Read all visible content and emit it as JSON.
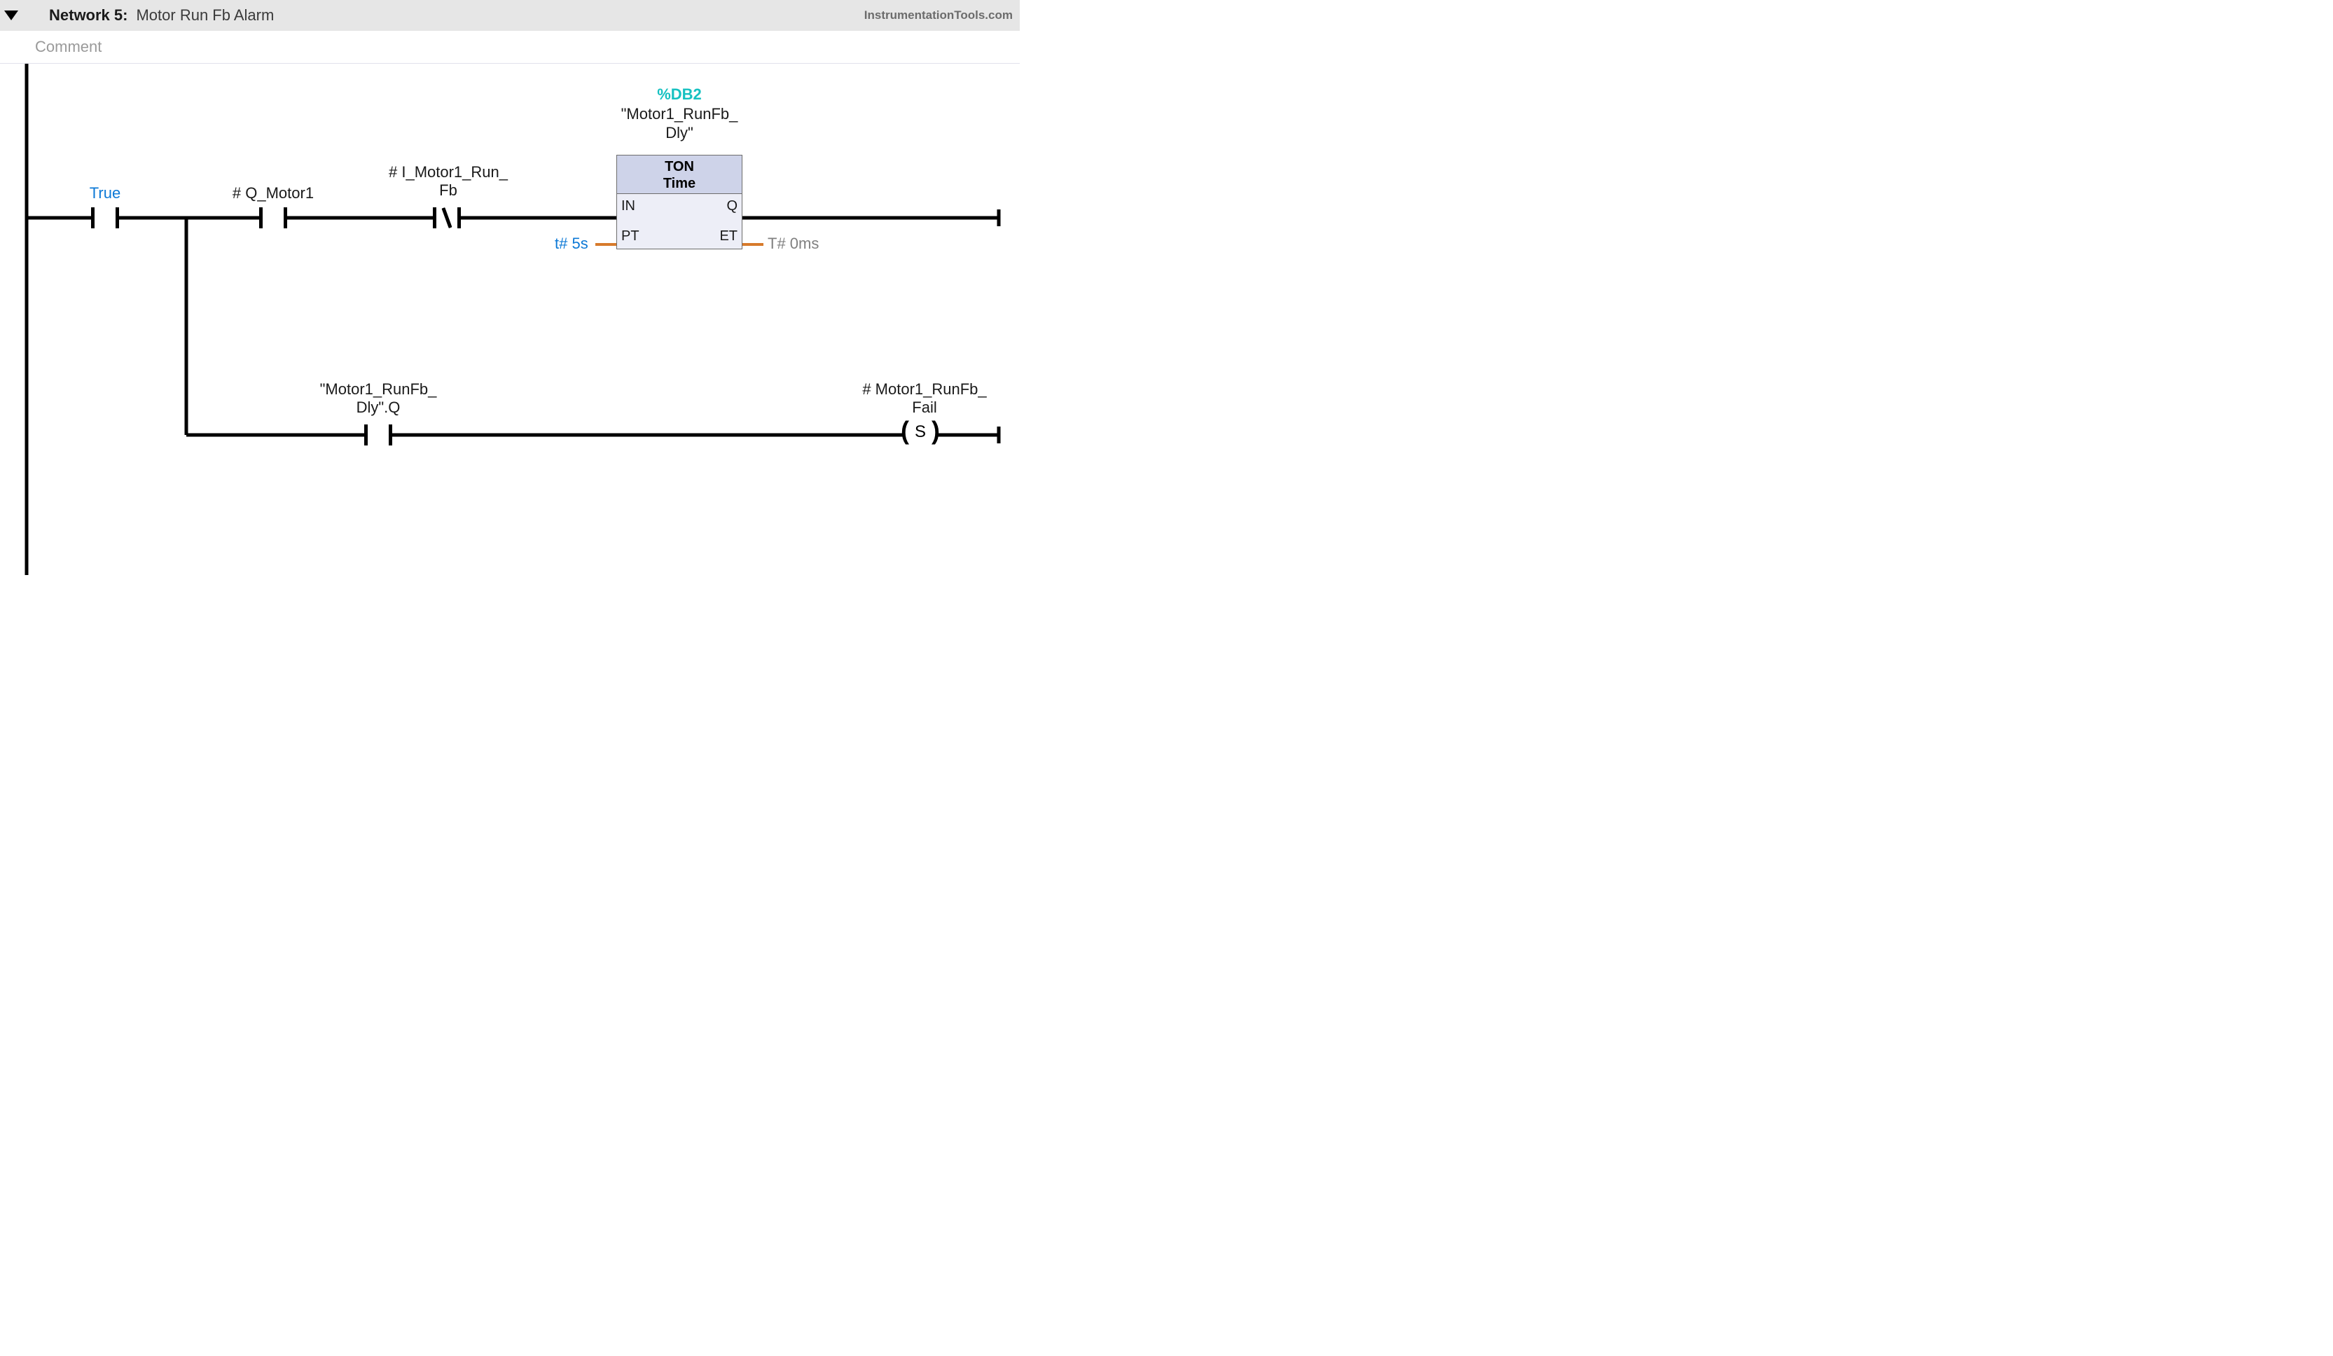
{
  "header": {
    "network_label": "Network 5:",
    "network_title": "Motor Run Fb Alarm",
    "brand": "InstrumentationTools.com"
  },
  "comment_placeholder": "Comment",
  "rung1": {
    "true_label": "True",
    "q_motor1_label": "# Q_Motor1",
    "i_motor1_runfb_line1": "# I_Motor1_Run_",
    "i_motor1_runfb_line2": "Fb"
  },
  "timer": {
    "db_label": "%DB2",
    "instance_line1": "\"Motor1_RunFb_",
    "instance_line2": "Dly\"",
    "type": "TON",
    "subtype": "Time",
    "pin_in": "IN",
    "pin_pt": "PT",
    "pin_q": "Q",
    "pin_et": "ET",
    "pt_value": "t# 5s",
    "et_value": "T# 0ms"
  },
  "rung2": {
    "contact_line1": "\"Motor1_RunFb_",
    "contact_line2": "Dly\".Q",
    "coil_line1": "# Motor1_RunFb_",
    "coil_line2": "Fail",
    "coil_letter": "S"
  }
}
